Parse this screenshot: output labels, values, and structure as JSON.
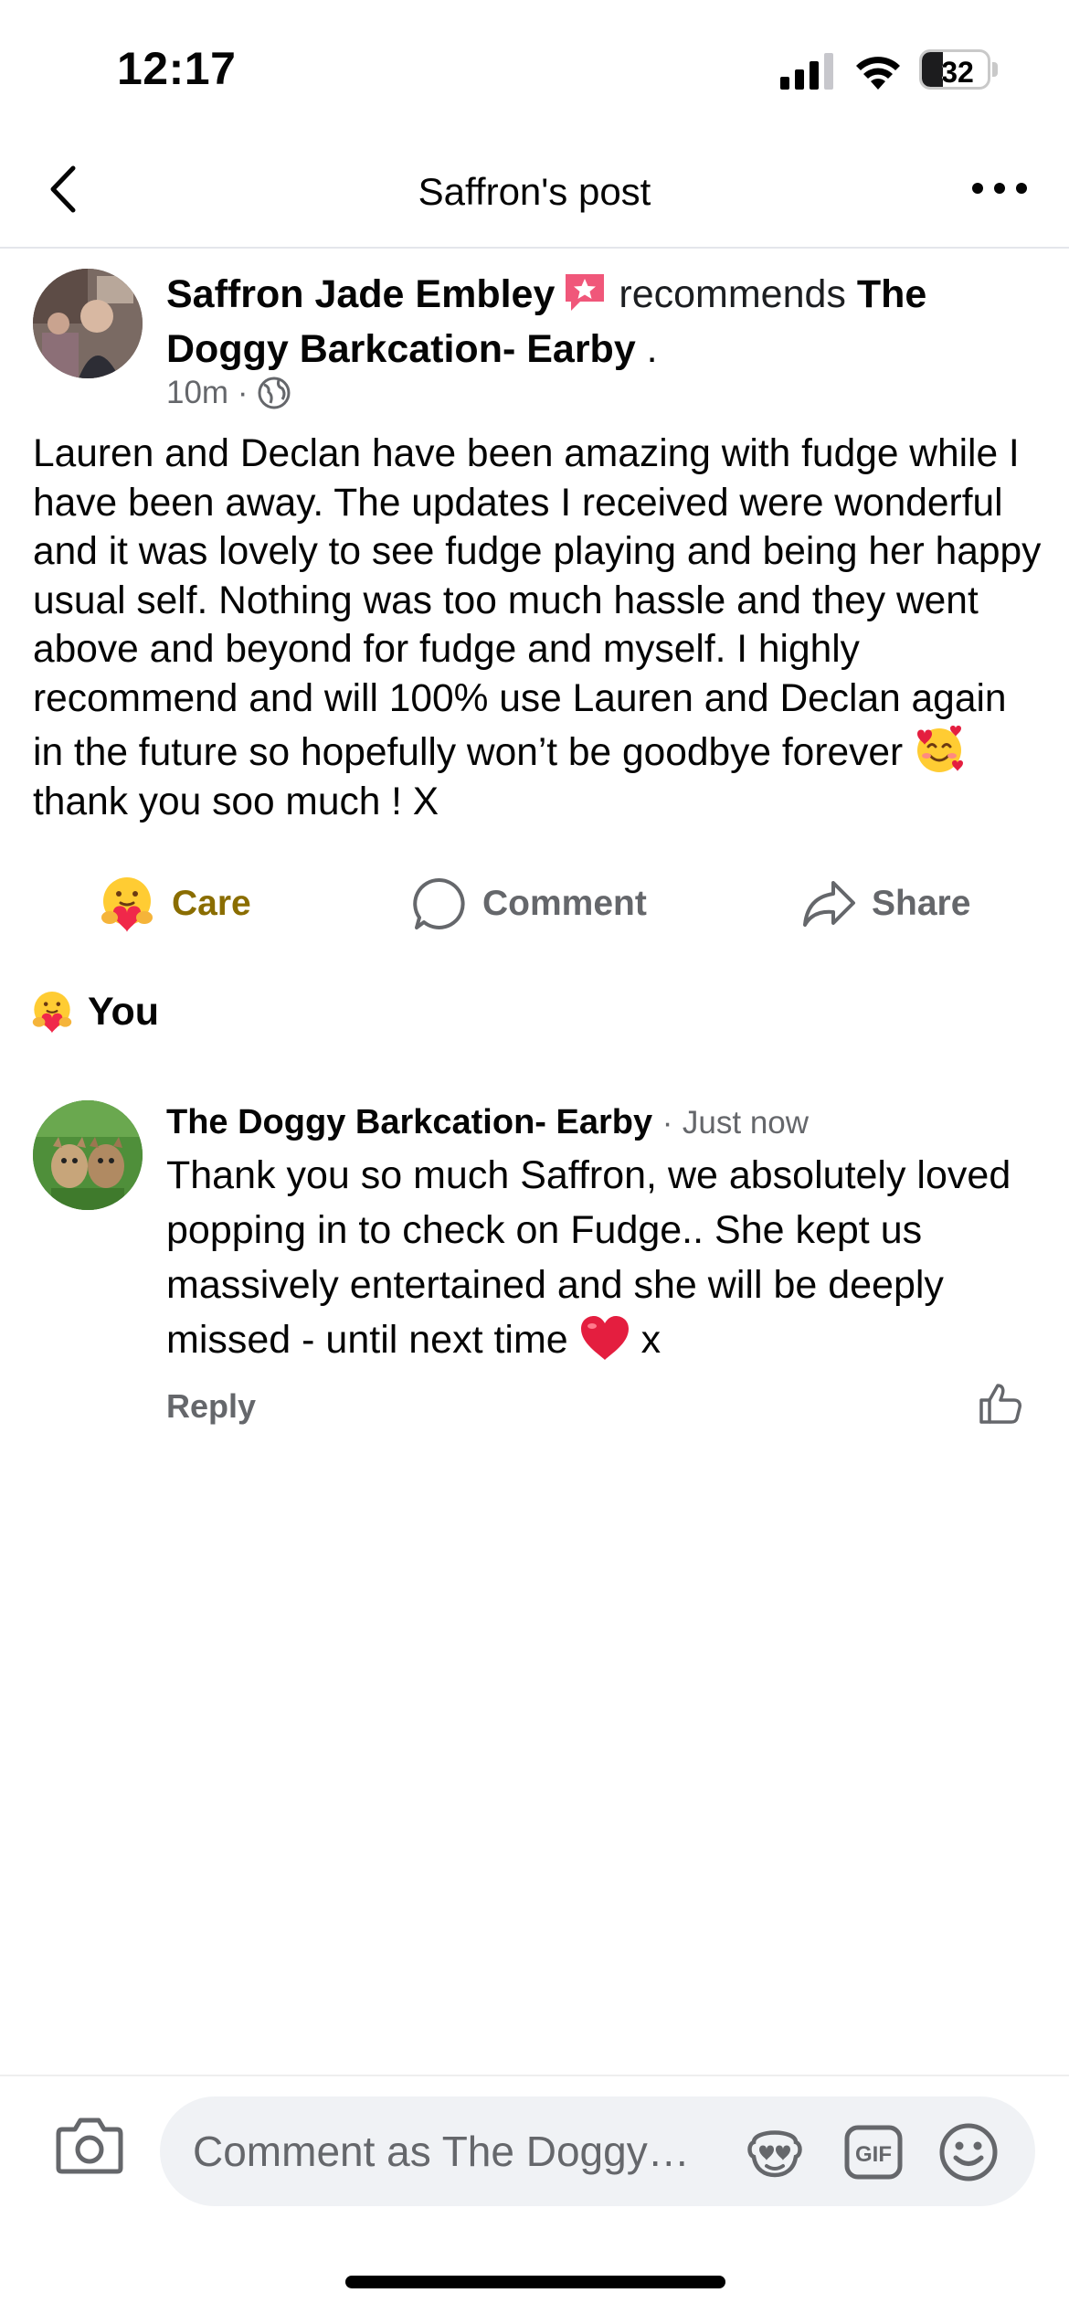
{
  "status_bar": {
    "time": "12:17",
    "battery": "32",
    "battery_level_fraction": 0.32
  },
  "nav": {
    "title": "Saffron's post",
    "back_icon": "chevron-left-icon",
    "more_icon": "ellipsis-icon"
  },
  "post": {
    "author": "Saffron Jade Embley",
    "recommends_text": "recommends",
    "page_name": "The Doggy Barkcation- Earby",
    "trailing": " .",
    "time": "10m",
    "separator": "·",
    "audience_icon": "globe-icon",
    "body_part1": "Lauren and Declan have been amazing with fudge while I have been away. The updates I received were wonderful and it was lovely to see fudge playing and being her happy usual self. Nothing was too much hassle and they went above and beyond for fudge and myself. I highly recommend and will 100% use Lauren and Declan again in the future so hopefully won’t be goodbye forever ",
    "body_emoji": "smiling-face-with-hearts-emoji",
    "body_part2": " thank you soo much ! X"
  },
  "actions": {
    "care": "Care",
    "comment": "Comment",
    "share": "Share",
    "care_color": "#8a6d00"
  },
  "reactions": {
    "reactor": "You",
    "reaction_icon": "care-reaction-icon"
  },
  "comment": {
    "author": "The Doggy Barkcation- Earby",
    "separator": "·",
    "time": "Just now",
    "body": "Thank you so much Saffron, we absolutely loved popping in to check on Fudge.. She kept us massively entertained and she will be deeply missed - until next time ",
    "body_emoji": "red-heart-emoji",
    "body_end": " x",
    "reply": "Reply"
  },
  "composer": {
    "placeholder": "Comment as The Doggy…",
    "camera_icon": "camera-icon",
    "sticker_icon": "avatar-sticker-icon",
    "gif_icon": "gif-icon",
    "emoji_icon": "emoji-icon"
  },
  "colors": {
    "secondary_text": "#65676b",
    "input_bg": "#f0f2f5",
    "heart": "#e41e3f"
  }
}
